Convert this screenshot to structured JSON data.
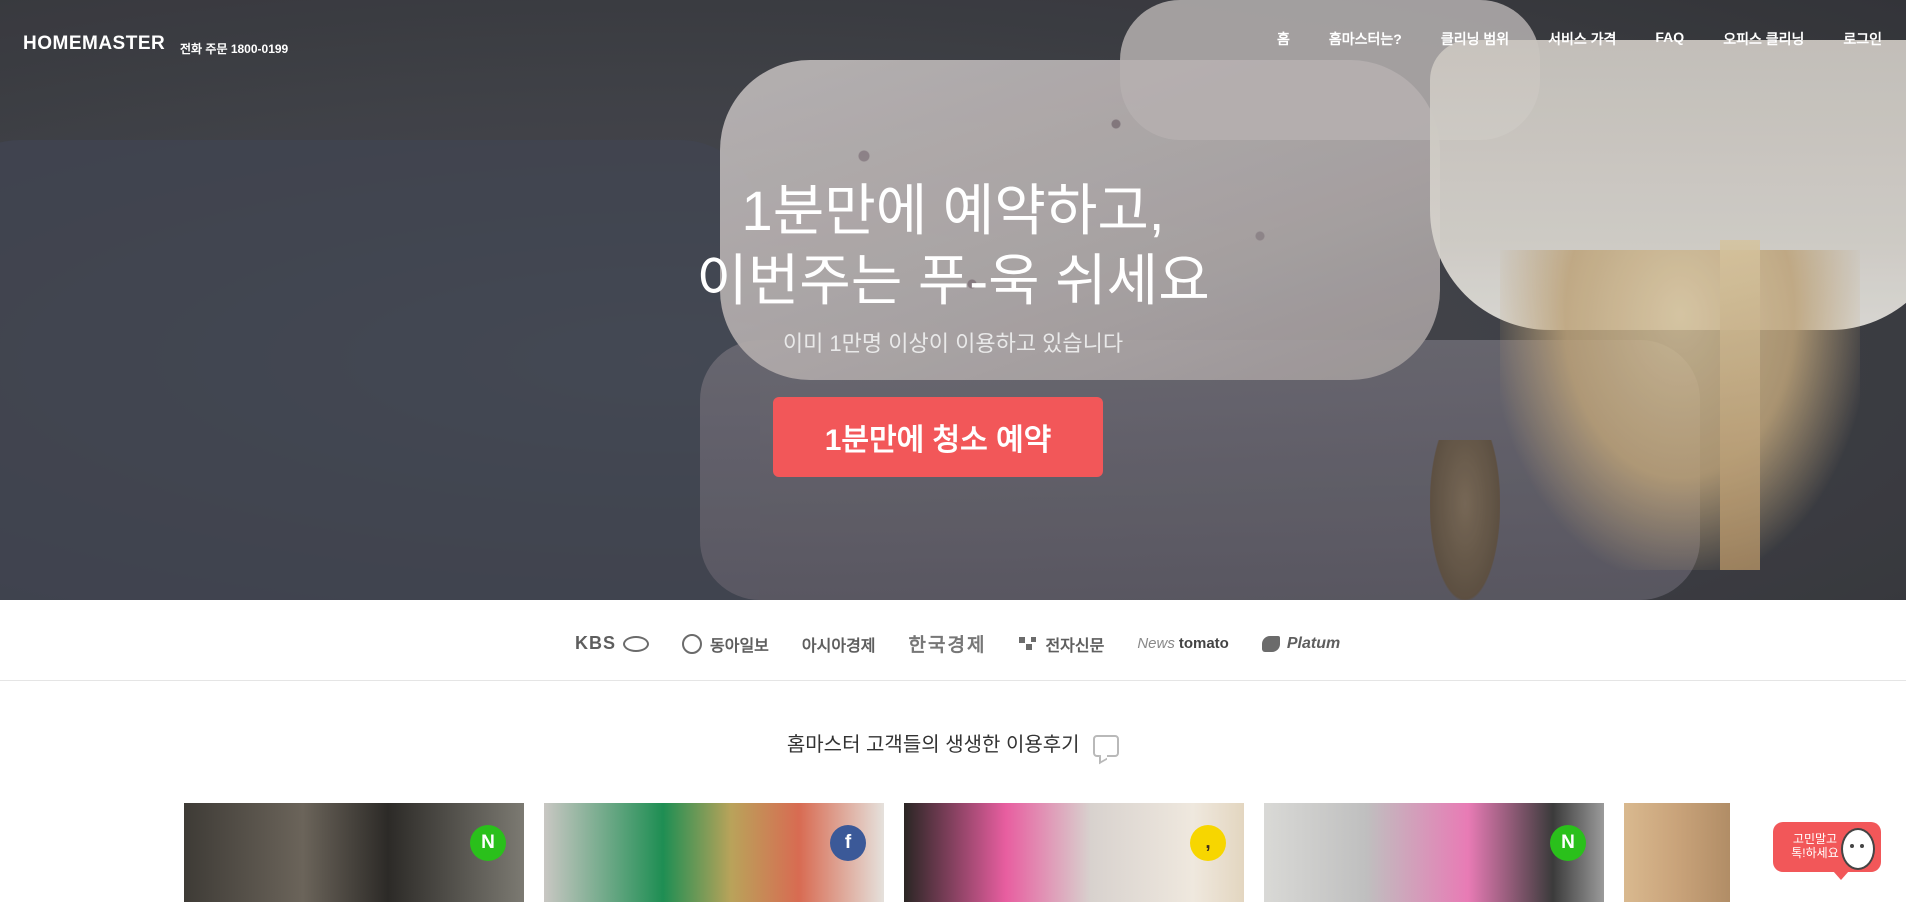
{
  "header": {
    "logo": "HOMEMASTER",
    "phone": "전화 주문 1800-0199",
    "nav": [
      "홈",
      "홈마스터는?",
      "클리닝 범위",
      "서비스 가격",
      "FAQ",
      "오피스 클리닝",
      "로그인"
    ]
  },
  "hero": {
    "headline_line1": "1분만에 예약하고,",
    "headline_line2": "이번주는 푸-욱 쉬세요",
    "subtitle": "이미 1만명 이상이 이용하고 있습니다",
    "cta": "1분만에 청소 예약"
  },
  "press": {
    "logos": [
      "KBS",
      "동아일보",
      "아시아경제",
      "한국경제",
      "전자신문",
      "News",
      "tomato",
      "Platum"
    ]
  },
  "reviews": {
    "title": "홈마스터 고객들의 생생한 이용후기",
    "badges": [
      "N",
      "f",
      ",",
      "N"
    ]
  },
  "chat": {
    "line1": "고민말고",
    "line2": "톡!하세요"
  },
  "colors": {
    "accent": "#f25759",
    "naver": "#2ac01b",
    "facebook": "#3b5998",
    "kakao": "#f7d600"
  }
}
